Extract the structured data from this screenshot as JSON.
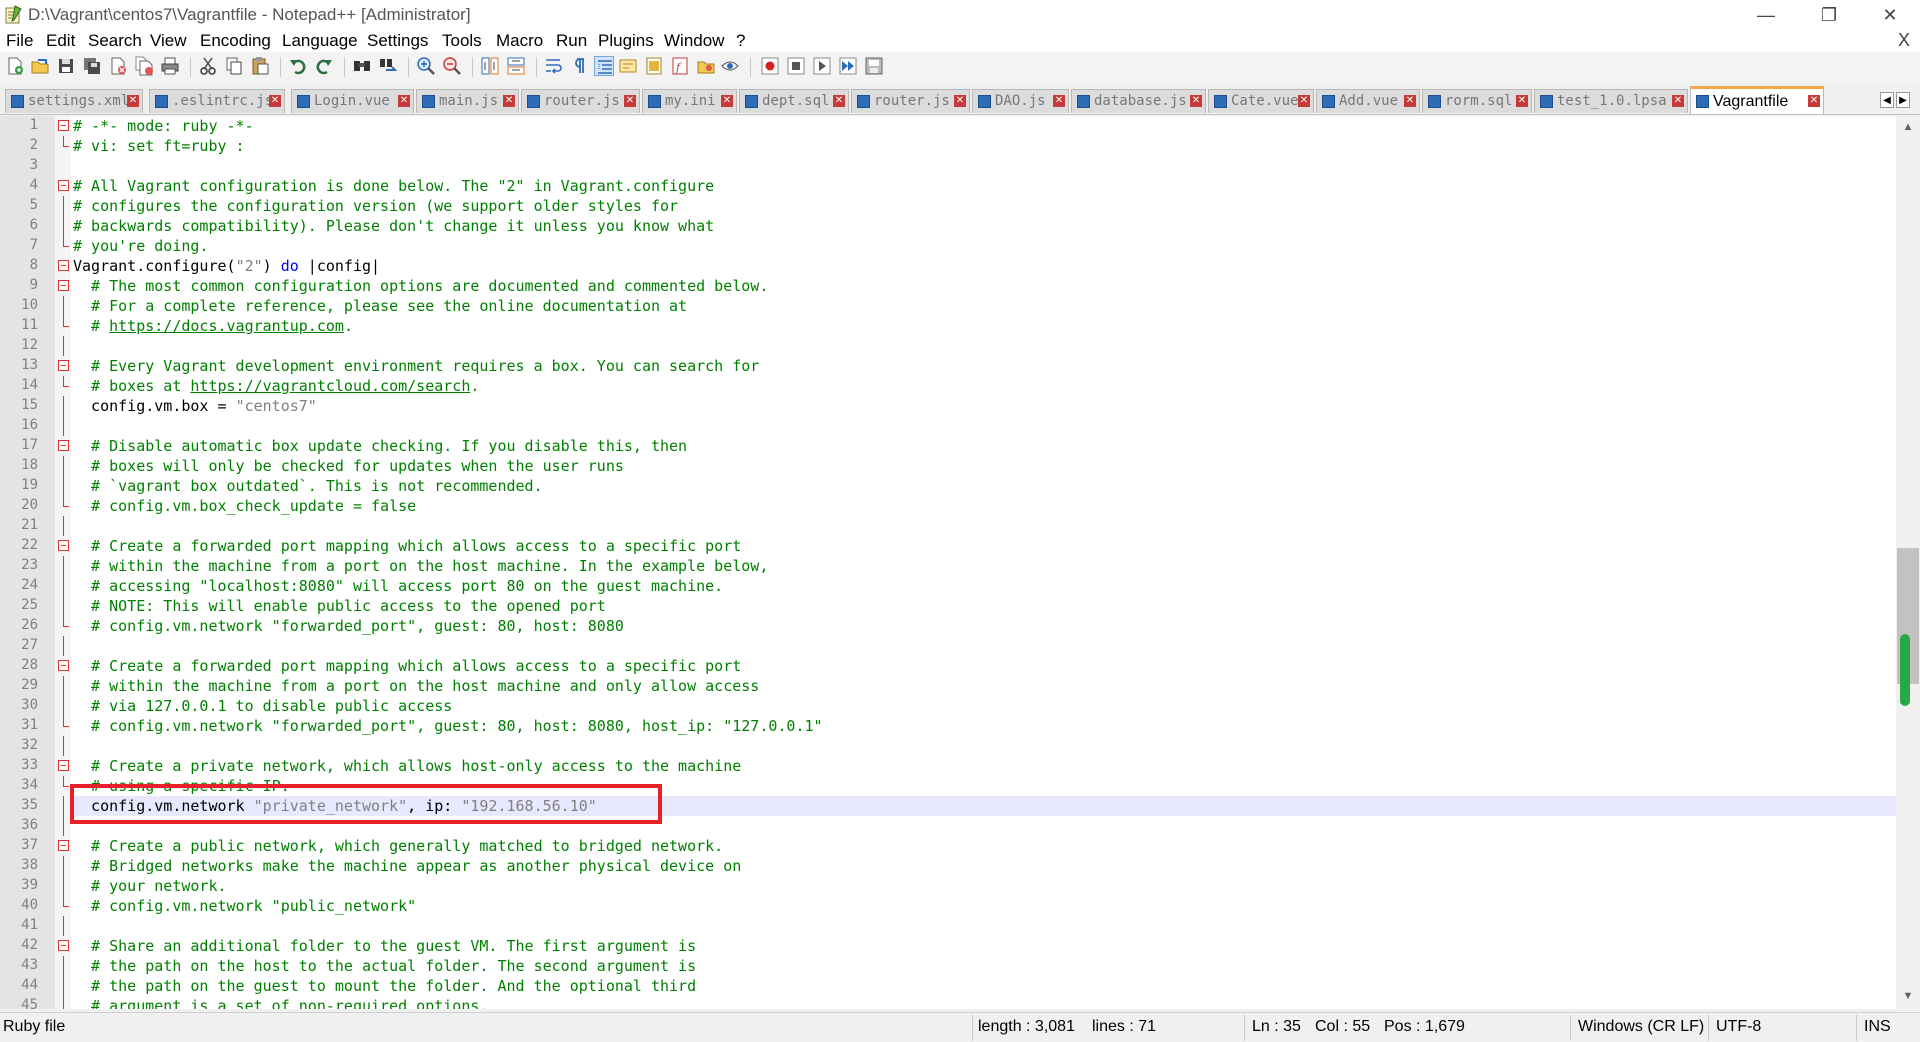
{
  "window": {
    "title": "D:\\Vagrant\\centos7\\Vagrantfile - Notepad++ [Administrator]",
    "minimize_glyph": "—",
    "maximize_glyph": "❐",
    "close_glyph": "✕"
  },
  "menu": {
    "items": [
      "File",
      "Edit",
      "Search",
      "View",
      "Encoding",
      "Language",
      "Settings",
      "Tools",
      "Macro",
      "Run",
      "Plugins",
      "Window",
      "?"
    ],
    "close_glyph": "X"
  },
  "toolbar": {
    "buttons": [
      "new-file",
      "open-file",
      "save",
      "save-all",
      "close",
      "close-all",
      "print",
      "cut",
      "copy",
      "paste",
      "undo",
      "redo",
      "find",
      "replace",
      "zoom-in",
      "zoom-out",
      "sync-vertical",
      "sync-horizontal",
      "word-wrap",
      "show-all-characters",
      "indent-guide",
      "udl",
      "doc-map",
      "function-list",
      "folder-as-workspace",
      "monitoring",
      "record-macro",
      "stop-recording",
      "play-macro",
      "run-macro-multiple",
      "save-macro"
    ]
  },
  "tabs": [
    {
      "name": "settings.xml",
      "active": false
    },
    {
      "name": ".eslintrc.js",
      "active": false
    },
    {
      "name": "Login.vue",
      "active": false
    },
    {
      "name": "main.js",
      "active": false
    },
    {
      "name": "router.js",
      "active": false
    },
    {
      "name": "my.ini",
      "active": false
    },
    {
      "name": "dept.sql",
      "active": false
    },
    {
      "name": "router.js",
      "active": false
    },
    {
      "name": "DAO.js",
      "active": false
    },
    {
      "name": "database.js",
      "active": false
    },
    {
      "name": "Cate.vue",
      "active": false
    },
    {
      "name": "Add.vue",
      "active": false
    },
    {
      "name": "rorm.sql",
      "active": false
    },
    {
      "name": "test_1.0.lpsa",
      "active": false
    },
    {
      "name": "Vagrantfile",
      "active": true
    }
  ],
  "tab_nav": {
    "prev": "◀",
    "next": "▶"
  },
  "editor": {
    "current_line": 35,
    "lines": [
      {
        "n": "1",
        "fold": "start",
        "segs": [
          {
            "t": "# -*- mode: ruby -*-",
            "c": "comment"
          }
        ]
      },
      {
        "n": "2",
        "fold": "end",
        "segs": [
          {
            "t": "# vi: set ft=ruby :",
            "c": "comment"
          }
        ]
      },
      {
        "n": "3",
        "fold": "",
        "segs": []
      },
      {
        "n": "4",
        "fold": "start",
        "segs": [
          {
            "t": "# All Vagrant configuration is done below. The \"2\" in Vagrant.configure",
            "c": "comment"
          }
        ]
      },
      {
        "n": "5",
        "fold": "line",
        "segs": [
          {
            "t": "# configures the configuration version (we support older styles for",
            "c": "comment"
          }
        ]
      },
      {
        "n": "6",
        "fold": "line",
        "segs": [
          {
            "t": "# backwards compatibility). Please don't change it unless you know what",
            "c": "comment"
          }
        ]
      },
      {
        "n": "7",
        "fold": "end",
        "segs": [
          {
            "t": "# you're doing.",
            "c": "comment"
          }
        ]
      },
      {
        "n": "8",
        "fold": "start",
        "segs": [
          {
            "t": "Vagrant.configure(",
            "c": "plain"
          },
          {
            "t": "\"2\"",
            "c": "string"
          },
          {
            "t": ") ",
            "c": "plain"
          },
          {
            "t": "do",
            "c": "kw"
          },
          {
            "t": " |config|",
            "c": "plain"
          }
        ]
      },
      {
        "n": "9",
        "fold": "start",
        "segs": [
          {
            "t": "  # The most common configuration options are documented and commented below.",
            "c": "comment"
          }
        ]
      },
      {
        "n": "10",
        "fold": "line",
        "segs": [
          {
            "t": "  # For a complete reference, please see the online documentation at",
            "c": "comment"
          }
        ]
      },
      {
        "n": "11",
        "fold": "end",
        "segs": [
          {
            "t": "  # ",
            "c": "comment"
          },
          {
            "t": "https://docs.vagrantup.com",
            "c": "link"
          },
          {
            "t": ".",
            "c": "comment"
          }
        ]
      },
      {
        "n": "12",
        "fold": "line",
        "segs": []
      },
      {
        "n": "13",
        "fold": "start",
        "segs": [
          {
            "t": "  # Every Vagrant development environment requires a box. You can search for",
            "c": "comment"
          }
        ]
      },
      {
        "n": "14",
        "fold": "end",
        "segs": [
          {
            "t": "  # boxes at ",
            "c": "comment"
          },
          {
            "t": "https://vagrantcloud.com/search",
            "c": "link"
          },
          {
            "t": ".",
            "c": "comment"
          }
        ]
      },
      {
        "n": "15",
        "fold": "line",
        "segs": [
          {
            "t": "  config.vm.box = ",
            "c": "plain"
          },
          {
            "t": "\"centos7\"",
            "c": "string"
          }
        ]
      },
      {
        "n": "16",
        "fold": "line",
        "segs": []
      },
      {
        "n": "17",
        "fold": "start",
        "segs": [
          {
            "t": "  # Disable automatic box update checking. If you disable this, then",
            "c": "comment"
          }
        ]
      },
      {
        "n": "18",
        "fold": "line",
        "segs": [
          {
            "t": "  # boxes will only be checked for updates when the user runs",
            "c": "comment"
          }
        ]
      },
      {
        "n": "19",
        "fold": "line",
        "segs": [
          {
            "t": "  # `vagrant box outdated`. This is not recommended.",
            "c": "comment"
          }
        ]
      },
      {
        "n": "20",
        "fold": "end",
        "segs": [
          {
            "t": "  # config.vm.box_check_update = false",
            "c": "comment"
          }
        ]
      },
      {
        "n": "21",
        "fold": "line",
        "segs": []
      },
      {
        "n": "22",
        "fold": "start",
        "segs": [
          {
            "t": "  # Create a forwarded port mapping which allows access to a specific port",
            "c": "comment"
          }
        ]
      },
      {
        "n": "23",
        "fold": "line",
        "segs": [
          {
            "t": "  # within the machine from a port on the host machine. In the example below,",
            "c": "comment"
          }
        ]
      },
      {
        "n": "24",
        "fold": "line",
        "segs": [
          {
            "t": "  # accessing \"localhost:8080\" will access port 80 on the guest machine.",
            "c": "comment"
          }
        ]
      },
      {
        "n": "25",
        "fold": "line",
        "segs": [
          {
            "t": "  # NOTE: This will enable public access to the opened port",
            "c": "comment"
          }
        ]
      },
      {
        "n": "26",
        "fold": "end",
        "segs": [
          {
            "t": "  # config.vm.network \"forwarded_port\", guest: 80, host: 8080",
            "c": "comment"
          }
        ]
      },
      {
        "n": "27",
        "fold": "line",
        "segs": []
      },
      {
        "n": "28",
        "fold": "start",
        "segs": [
          {
            "t": "  # Create a forwarded port mapping which allows access to a specific port",
            "c": "comment"
          }
        ]
      },
      {
        "n": "29",
        "fold": "line",
        "segs": [
          {
            "t": "  # within the machine from a port on the host machine and only allow access",
            "c": "comment"
          }
        ]
      },
      {
        "n": "30",
        "fold": "line",
        "segs": [
          {
            "t": "  # via 127.0.0.1 to disable public access",
            "c": "comment"
          }
        ]
      },
      {
        "n": "31",
        "fold": "end",
        "segs": [
          {
            "t": "  # config.vm.network \"forwarded_port\", guest: 80, host: 8080, host_ip: \"127.0.0.1\"",
            "c": "comment"
          }
        ]
      },
      {
        "n": "32",
        "fold": "line",
        "segs": []
      },
      {
        "n": "33",
        "fold": "start",
        "segs": [
          {
            "t": "  # Create a private network, which allows host-only access to the machine",
            "c": "comment"
          }
        ]
      },
      {
        "n": "34",
        "fold": "end",
        "segs": [
          {
            "t": "  # using a specific IP.",
            "c": "comment"
          }
        ]
      },
      {
        "n": "35",
        "fold": "line",
        "segs": [
          {
            "t": "  config.vm.network ",
            "c": "plain"
          },
          {
            "t": "\"private_network\"",
            "c": "string"
          },
          {
            "t": ", ip: ",
            "c": "plain"
          },
          {
            "t": "\"192.168.56.10\"",
            "c": "string"
          }
        ]
      },
      {
        "n": "36",
        "fold": "line",
        "segs": []
      },
      {
        "n": "37",
        "fold": "start",
        "segs": [
          {
            "t": "  # Create a public network, which generally matched to bridged network.",
            "c": "comment"
          }
        ]
      },
      {
        "n": "38",
        "fold": "line",
        "segs": [
          {
            "t": "  # Bridged networks make the machine appear as another physical device on",
            "c": "comment"
          }
        ]
      },
      {
        "n": "39",
        "fold": "line",
        "segs": [
          {
            "t": "  # your network.",
            "c": "comment"
          }
        ]
      },
      {
        "n": "40",
        "fold": "end",
        "segs": [
          {
            "t": "  # config.vm.network \"public_network\"",
            "c": "comment"
          }
        ]
      },
      {
        "n": "41",
        "fold": "line",
        "segs": []
      },
      {
        "n": "42",
        "fold": "start",
        "segs": [
          {
            "t": "  # Share an additional folder to the guest VM. The first argument is",
            "c": "comment"
          }
        ]
      },
      {
        "n": "43",
        "fold": "line",
        "segs": [
          {
            "t": "  # the path on the host to the actual folder. The second argument is",
            "c": "comment"
          }
        ]
      },
      {
        "n": "44",
        "fold": "line",
        "segs": [
          {
            "t": "  # the path on the guest to mount the folder. And the optional third",
            "c": "comment"
          }
        ]
      },
      {
        "n": "45",
        "fold": "line",
        "segs": [
          {
            "t": "  # argument is a set of non-required options.",
            "c": "comment"
          }
        ]
      }
    ]
  },
  "scrollbar": {
    "up": "▲",
    "down": "▼"
  },
  "status": {
    "file_type": "Ruby file",
    "length": "length : 3,081",
    "lines": "lines : 71",
    "ln": "Ln : 35",
    "col": "Col : 55",
    "pos": "Pos : 1,679",
    "eol": "Windows (CR LF)",
    "encoding": "UTF-8",
    "mode": "INS"
  },
  "colors": {
    "comment": "#008000",
    "string": "#808080",
    "keyword": "#0000ff",
    "highlight_box": "#e8202a",
    "current_line": "#e8e8ff",
    "active_tab_accent": "#f5a64a"
  }
}
